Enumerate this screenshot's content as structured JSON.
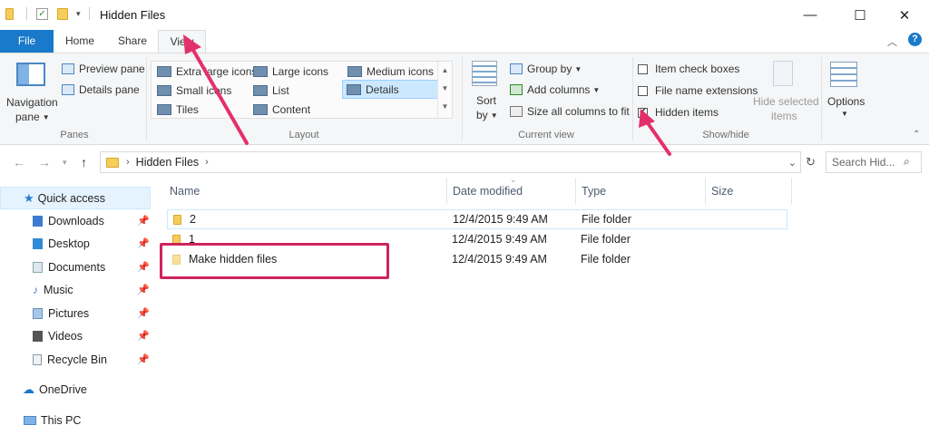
{
  "window": {
    "title": "Hidden Files",
    "controls": {
      "minimize": "—",
      "maximize": "☐",
      "close": "✕"
    }
  },
  "tabs": [
    {
      "label": "File"
    },
    {
      "label": "Home"
    },
    {
      "label": "Share"
    },
    {
      "label": "View"
    }
  ],
  "ribbon": {
    "panes": {
      "group_label": "Panes",
      "navigation_pane": [
        "Navigation",
        "pane"
      ],
      "preview_pane": "Preview pane",
      "details_pane": "Details pane"
    },
    "layout": {
      "group_label": "Layout",
      "items": [
        {
          "label": "Extra large icons"
        },
        {
          "label": "Large icons"
        },
        {
          "label": "Medium icons"
        },
        {
          "label": "Small icons"
        },
        {
          "label": "List"
        },
        {
          "label": "Details",
          "selected": true
        },
        {
          "label": "Tiles"
        },
        {
          "label": "Content"
        }
      ]
    },
    "current_view": {
      "group_label": "Current view",
      "sort_by": [
        "Sort",
        "by"
      ],
      "group_by": "Group by",
      "add_columns": "Add columns",
      "size_all_columns": "Size all columns to fit"
    },
    "show_hide": {
      "group_label": "Show/hide",
      "item_check_boxes": "Item check boxes",
      "file_name_extensions": "File name extensions",
      "hidden_items": "Hidden items",
      "hidden_items_checked": true,
      "hide_selected": [
        "Hide selected",
        "items"
      ]
    },
    "options": "Options"
  },
  "address": {
    "path": "Hidden Files",
    "search_placeholder": "Search Hid..."
  },
  "nav": {
    "quick_access": "Quick access",
    "items": [
      {
        "label": "Downloads",
        "pinned": true
      },
      {
        "label": "Desktop",
        "pinned": true
      },
      {
        "label": "Documents",
        "pinned": true
      },
      {
        "label": "Music",
        "pinned": true
      },
      {
        "label": "Pictures",
        "pinned": true
      },
      {
        "label": "Videos",
        "pinned": true
      },
      {
        "label": "Recycle Bin",
        "pinned": true
      }
    ],
    "onedrive": "OneDrive",
    "this_pc": "This PC"
  },
  "columns": {
    "name": "Name",
    "date_modified": "Date modified",
    "type": "Type",
    "size": "Size"
  },
  "files": [
    {
      "name": "2",
      "date": "12/4/2015 9:49 AM",
      "type": "File folder",
      "size": ""
    },
    {
      "name": "1",
      "date": "12/4/2015 9:49 AM",
      "type": "File folder",
      "size": ""
    },
    {
      "name": "Make hidden files",
      "date": "12/4/2015 9:49 AM",
      "type": "File folder",
      "size": ""
    }
  ],
  "colors": {
    "accent": "#1979ca",
    "annotation": "#d0245f",
    "folder": "#f5cd5b"
  }
}
